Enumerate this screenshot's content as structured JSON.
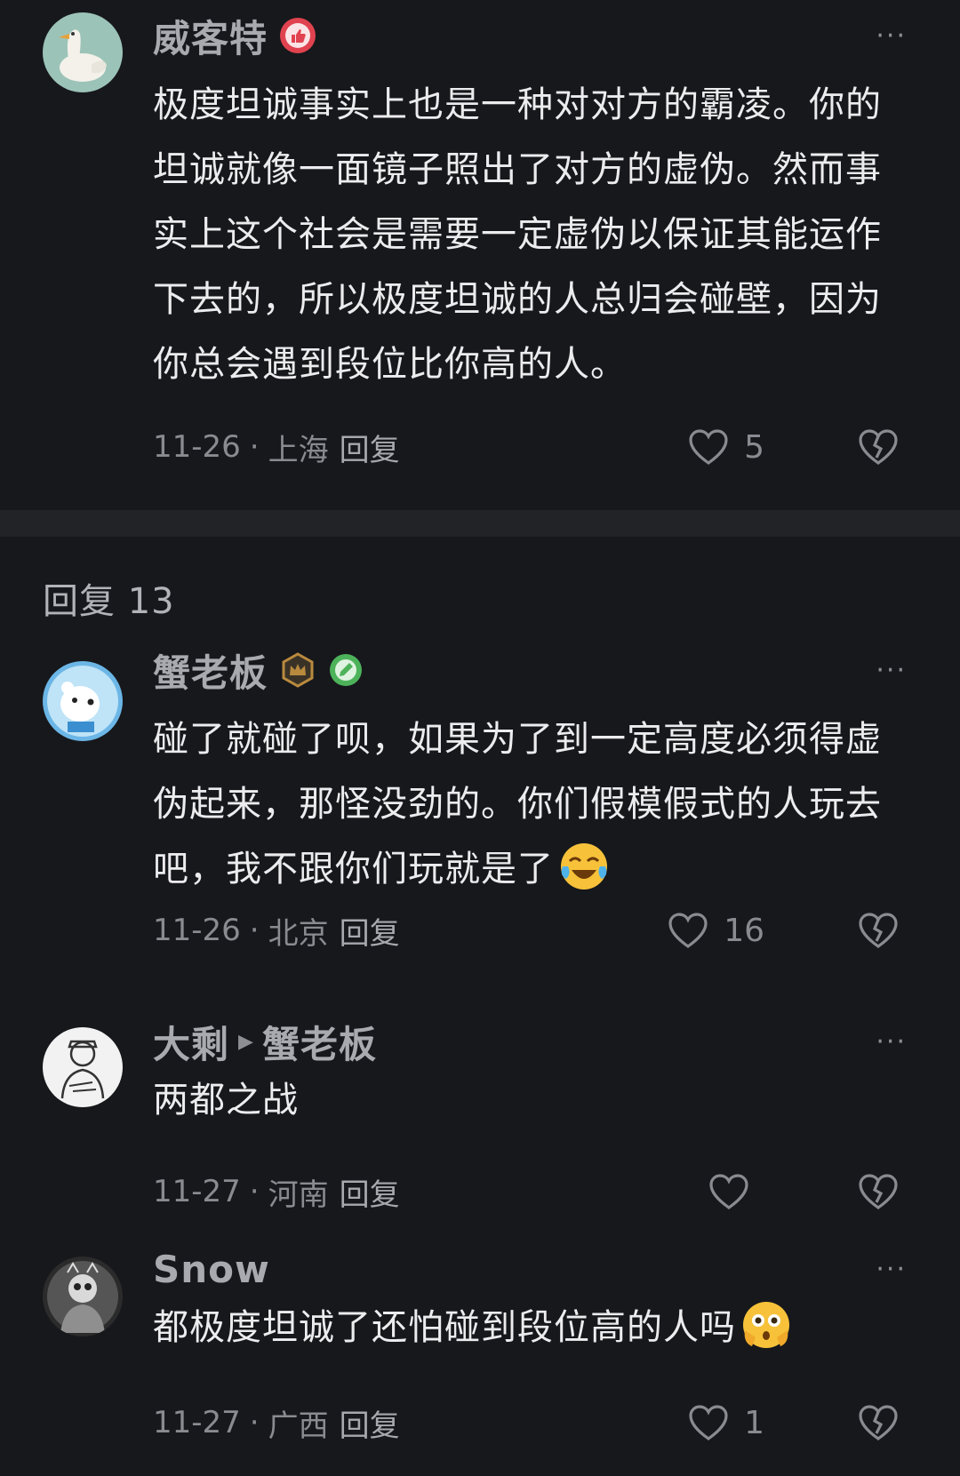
{
  "main_comment": {
    "username": "威客特",
    "text": "极度坦诚事实上也是一种对对方的霸凌。你的坦诚就像一面镜子照出了对方的虚伪。然而事实上这个社会是需要一定虚伪以保证其能运作下去的，所以极度坦诚的人总归会碰壁，因为你总会遇到段位比你高的人。",
    "date": "11-26",
    "location": "上海",
    "reply_label": "回复",
    "likes": "5",
    "more": "···"
  },
  "replies_header": "回复 13",
  "replies": [
    {
      "username": "蟹老板",
      "text": "碰了就碰了呗，如果为了到一定高度必须得虚伪起来，那怪没劲的。你们假模假式的人玩去吧，我不跟你们玩就是了",
      "emoji": "laughing-crying-emoji",
      "date": "11-26",
      "location": "北京",
      "reply_label": "回复",
      "likes": "16",
      "more": "···"
    },
    {
      "username": "大剩",
      "reply_to": "蟹老板",
      "text": "两都之战",
      "date": "11-27",
      "location": "河南",
      "reply_label": "回复",
      "likes": "",
      "more": "···"
    },
    {
      "username": "Snow",
      "text": "都极度坦诚了还怕碰到段位高的人吗",
      "emoji": "flushed-hands-emoji",
      "date": "11-27",
      "location": "广西",
      "reply_label": "回复",
      "likes": "1",
      "more": "···"
    }
  ],
  "colors": {
    "background": "#17181c",
    "text": "#ececee",
    "muted": "#8a8b91",
    "badge_red": "#e0434f",
    "badge_gold": "#b98a3e",
    "badge_green": "#4db35a"
  }
}
